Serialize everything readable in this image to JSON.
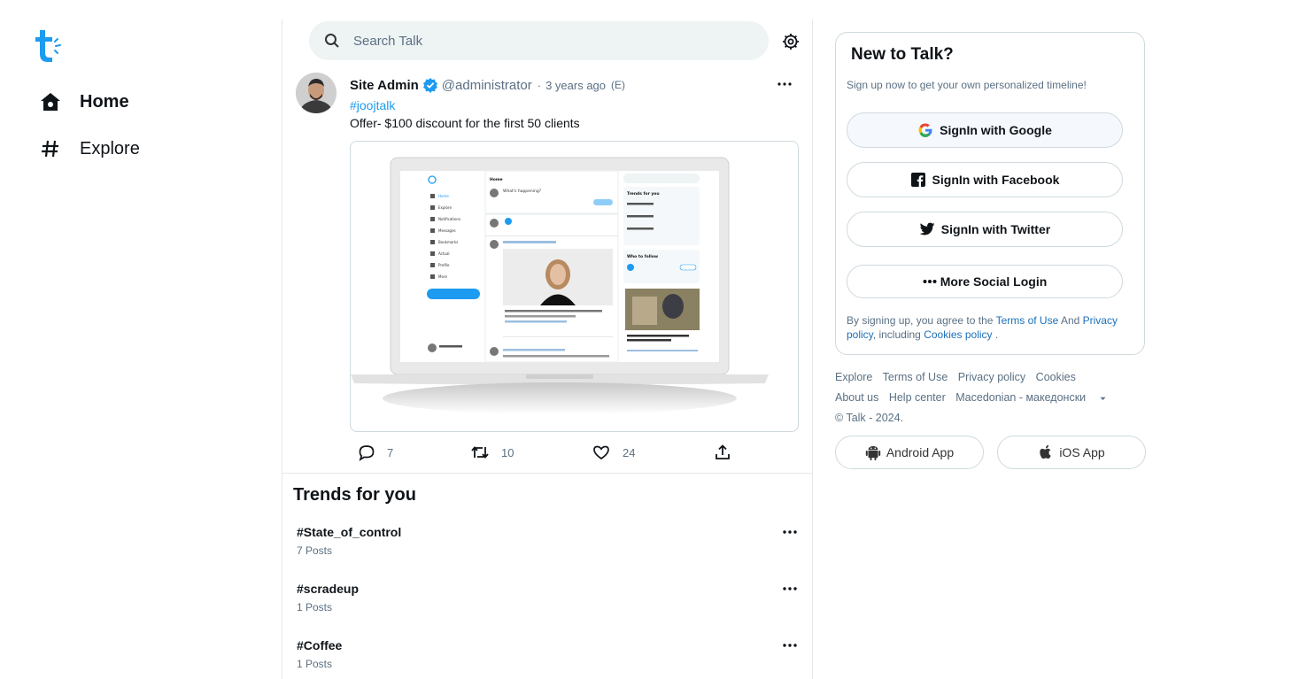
{
  "nav": {
    "logo_icon": "talk-logo-icon",
    "items": [
      {
        "label": "Home",
        "icon": "home-icon",
        "active": true
      },
      {
        "label": "Explore",
        "icon": "hashtag-icon",
        "active": false
      }
    ]
  },
  "search": {
    "placeholder": "Search Talk"
  },
  "post": {
    "author_name": "Site Admin",
    "handle": "@administrator",
    "separator": "·",
    "time": "3 years ago",
    "edited": "(E)",
    "hashtag": "#joojtalk",
    "text": "Offer- $100 discount for the first 50 clients",
    "media_preview": {
      "home": "Home",
      "prompt": "What's happening?",
      "trends": "Trends for you",
      "who_to_follow": "Who to follow",
      "menu": [
        "Home",
        "Explore",
        "Notifications",
        "Messages",
        "Bookmarks",
        "Actual",
        "Profile",
        "More"
      ]
    },
    "counts": {
      "comments": "7",
      "reposts": "10",
      "likes": "24"
    }
  },
  "trends": {
    "title": "Trends for you",
    "items": [
      {
        "tag": "#State_of_control",
        "count": "7 Posts"
      },
      {
        "tag": "#scradeup",
        "count": "1 Posts"
      },
      {
        "tag": "#Coffee",
        "count": "1 Posts"
      }
    ]
  },
  "signup": {
    "title": "New to Talk?",
    "subtitle": "Sign up now to get your own personalized timeline!",
    "google": "SignIn with Google",
    "facebook": "SignIn with Facebook",
    "twitter": "SignIn with Twitter",
    "more": "More Social Login",
    "terms_prefix": "By signing up, you agree to the",
    "terms_link": "Terms of Use",
    "terms_and": "And",
    "privacy_link": "Privacy policy",
    "including": ", including",
    "cookies_link": "Cookies policy",
    "terms_end": "."
  },
  "footer": {
    "row1": [
      "Explore",
      "Terms of Use",
      "Privacy policy",
      "Cookies"
    ],
    "row2": [
      "About us",
      "Help center",
      "Macedonian - македонски"
    ],
    "copyright": "© Talk - 2024.",
    "android": "Android App",
    "ios": "iOS App"
  },
  "colors": {
    "accent": "#1d9bf0",
    "google_blue": "#4285f4",
    "verified": "#1d9bf0"
  }
}
